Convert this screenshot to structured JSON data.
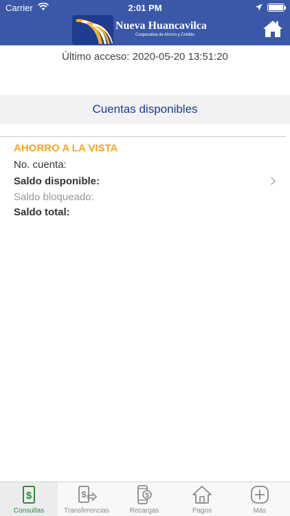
{
  "status_bar": {
    "carrier": "Carrier",
    "time": "2:01 PM"
  },
  "header": {
    "brand_name": "Nueva Huancavilca",
    "brand_subtitle": "Cooperativa de Ahorro y Crédito",
    "home_icon": "home-icon"
  },
  "last_access": "Último acceso: 2020-05-20 13:51:20",
  "section_title": "Cuentas disponibles",
  "account": {
    "type": "AHORRO A LA VISTA",
    "number_label": "No. cuenta:",
    "available_label": "Saldo disponible:",
    "blocked_label": "Saldo bloqueado:",
    "total_label": "Saldo total:"
  },
  "tabs": [
    {
      "label": "Consultas",
      "icon": "money-document-icon",
      "active": true
    },
    {
      "label": "Transferencias",
      "icon": "transfer-icon",
      "active": false
    },
    {
      "label": "Recargas",
      "icon": "phone-recharge-icon",
      "active": false
    },
    {
      "label": "Pagos",
      "icon": "home-payment-icon",
      "active": false
    },
    {
      "label": "Más",
      "icon": "plus-icon",
      "active": false
    }
  ],
  "colors": {
    "header_bg": "#3a57a8",
    "accent_orange": "#f5a623",
    "title_blue": "#1f3c8f",
    "active_tab_green": "#2e8b3a"
  }
}
